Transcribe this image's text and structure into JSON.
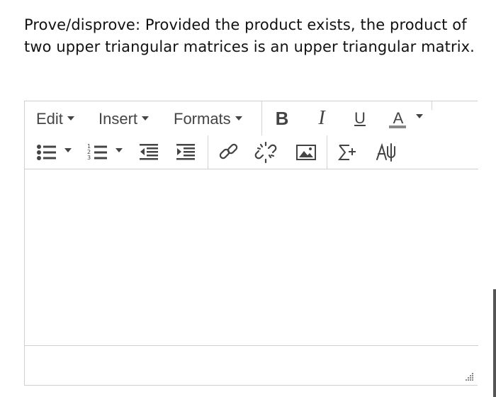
{
  "question": {
    "text": "Prove/disprove: Provided the product exists, the product of two upper triangular matrices is an upper triangular matrix."
  },
  "toolbar": {
    "menus": {
      "edit": "Edit",
      "insert": "Insert",
      "formats": "Formats"
    },
    "format_buttons": {
      "bold": "B",
      "italic": "I",
      "underline": "U",
      "font_color": "A"
    },
    "icons": [
      "bullet-list-icon",
      "numbered-list-icon",
      "outdent-icon",
      "indent-icon",
      "link-icon",
      "unlink-icon",
      "image-icon",
      "equation-icon",
      "special-character-icon"
    ],
    "icon_color": "#444444"
  },
  "editor": {
    "content": "",
    "border_color": "#cfcfcf"
  }
}
